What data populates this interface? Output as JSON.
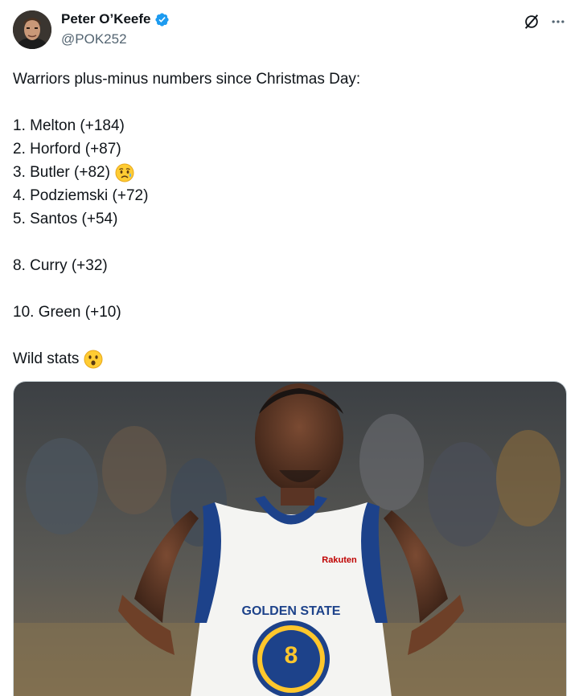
{
  "tweet": {
    "author": {
      "display_name": "Peter O’Keefe",
      "handle": "@POK252",
      "verified": true
    },
    "lines": {
      "l1": "Warriors plus-minus numbers since Christmas Day:",
      "l2": "1. Melton (+184)",
      "l3": "2. Horford (+87)",
      "l4": "3. Butler (+82)",
      "l5": "4. Podziemski (+72)",
      "l6": "5. Santos (+54)",
      "l7": "8. Curry (+32)",
      "l8": "10. Green (+10)",
      "l9": "Wild stats"
    },
    "emojis": {
      "butler_emoji": "sad-but-relieved-face",
      "wild_emoji": "astonished-face"
    },
    "photo": {
      "subject": "basketball player in white Golden State jersey number 8",
      "jersey_text": "GOLDEN STATE",
      "jersey_number": "8",
      "sponsor": "Rakuten"
    }
  },
  "colors": {
    "text": "#0f1419",
    "secondary": "#536471",
    "verified": "#1d9bf0",
    "warriors_blue": "#1d428a",
    "warriors_gold": "#ffc72c"
  },
  "icons": {
    "grok": "grok-icon",
    "more": "more-icon"
  }
}
